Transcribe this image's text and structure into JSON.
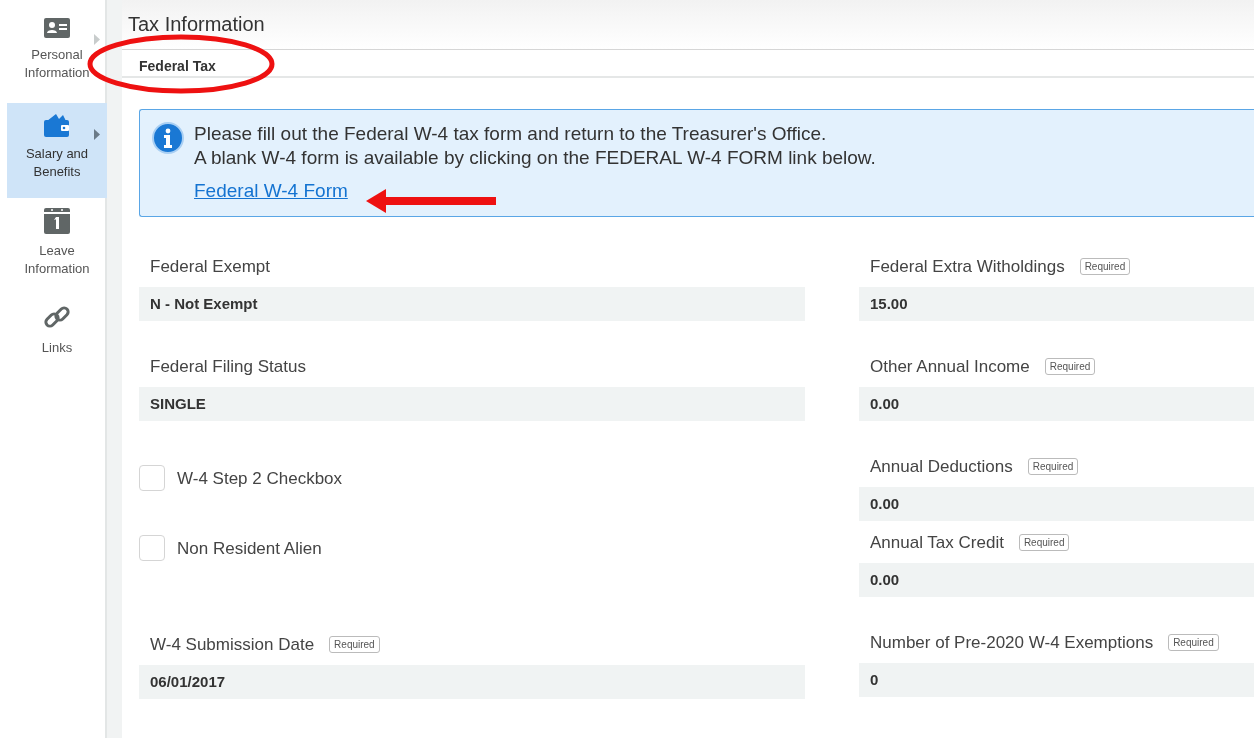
{
  "sidebar": {
    "items": [
      {
        "label": "Personal Information",
        "kind": "id-card",
        "selected": false,
        "expandable": true
      },
      {
        "label": "Salary and Benefits",
        "kind": "wallet",
        "selected": true,
        "expandable": true
      },
      {
        "label": "Leave Information",
        "kind": "calendar",
        "selected": false,
        "expandable": false
      },
      {
        "label": "Links",
        "kind": "link",
        "selected": false,
        "expandable": false
      }
    ]
  },
  "page_title": "Tax Information",
  "section_title": "Federal Tax",
  "notice": {
    "lines": [
      "Please fill out the Federal W-4 tax form and return to the Treasurer's Office.",
      "A blank W-4 form is available by clicking on the FEDERAL W-4 FORM link below."
    ],
    "link": "Federal W-4 Form"
  },
  "left_fields": [
    {
      "kind": "field",
      "label": "Federal Exempt",
      "value": "N - Not Exempt"
    },
    {
      "kind": "field",
      "label": "Federal Filing Status",
      "value": "SINGLE"
    },
    {
      "kind": "checkbox",
      "label": "W-4 Step 2 Checkbox",
      "checked": false
    },
    {
      "kind": "checkbox",
      "label": "Non Resident Alien",
      "checked": false
    },
    {
      "kind": "field",
      "label": "W-4 Submission Date",
      "badge": "Required",
      "value": "06/01/2017"
    }
  ],
  "right_fields": [
    {
      "kind": "field",
      "label": "Federal Extra Witholdings",
      "badge": "Required",
      "value": "15.00"
    },
    {
      "kind": "field",
      "label": "Other Annual Income",
      "badge": "Required",
      "value": "0.00"
    },
    {
      "kind": "field",
      "label": "Annual Deductions",
      "badge": "Required",
      "value": "0.00"
    },
    {
      "kind": "field",
      "label": "Annual Tax Credit",
      "badge": "Required",
      "value": "0.00"
    },
    {
      "kind": "field",
      "label": "Number of Pre-2020 W-4 Exemptions",
      "badge": "Required",
      "value": "0"
    }
  ]
}
